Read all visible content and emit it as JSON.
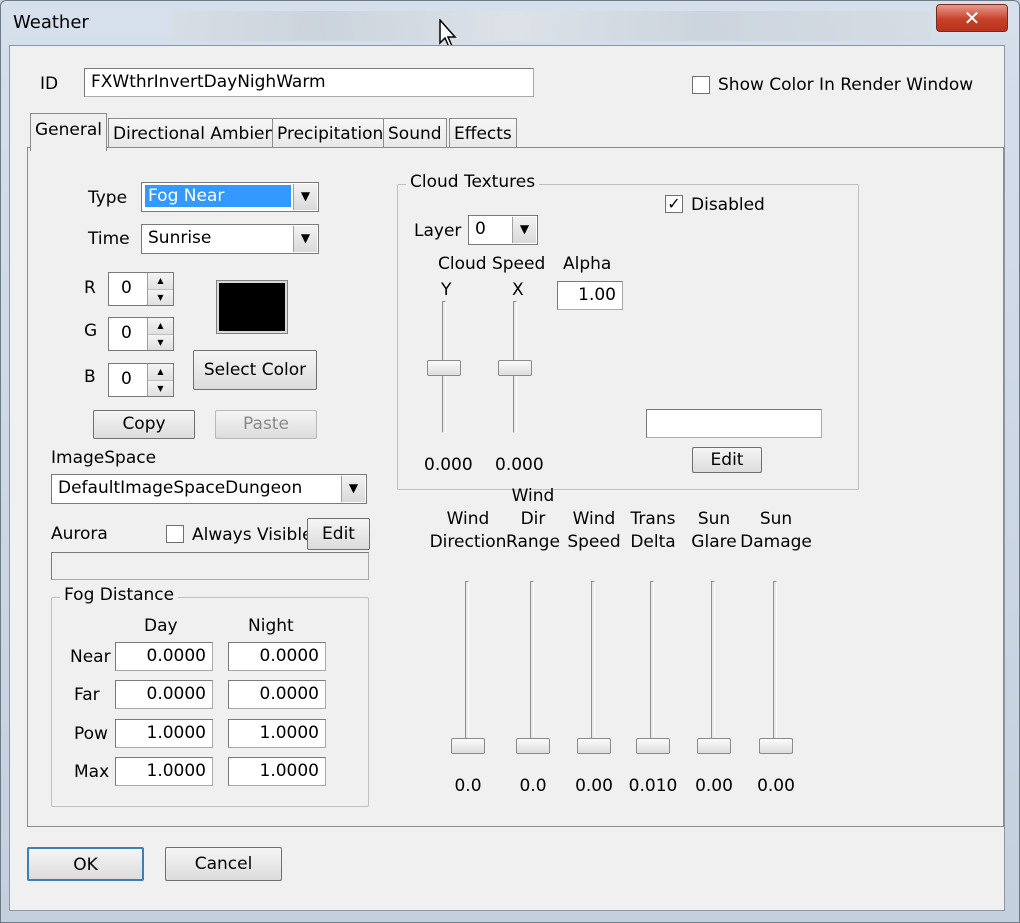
{
  "window": {
    "title": "Weather",
    "close": "✕"
  },
  "id_field": {
    "label": "ID",
    "value": "FXWthrInvertDayNighWarm"
  },
  "show_color": {
    "label": "Show Color In Render Window",
    "checked": false
  },
  "tabs": [
    {
      "label": "General",
      "active": true
    },
    {
      "label": "Directional Ambient"
    },
    {
      "label": "Precipitation"
    },
    {
      "label": "Sound"
    },
    {
      "label": "Effects"
    }
  ],
  "general": {
    "type": {
      "label": "Type",
      "value": "Fog Near"
    },
    "time": {
      "label": "Time",
      "value": "Sunrise"
    },
    "r": {
      "label": "R",
      "value": "0"
    },
    "g": {
      "label": "G",
      "value": "0"
    },
    "b": {
      "label": "B",
      "value": "0"
    },
    "color_swatch": "#000000",
    "select_color": "Select Color",
    "copy": "Copy",
    "paste": "Paste",
    "imagespace": {
      "label": "ImageSpace",
      "value": "DefaultImageSpaceDungeon"
    },
    "aurora": {
      "label": "Aurora",
      "always_visible": "Always Visible",
      "edit": "Edit",
      "path": ""
    },
    "fog": {
      "title": "Fog Distance",
      "day": "Day",
      "night": "Night",
      "rows": [
        {
          "label": "Near",
          "day": "0.0000",
          "night": "0.0000"
        },
        {
          "label": "Far",
          "day": "0.0000",
          "night": "0.0000"
        },
        {
          "label": "Pow",
          "day": "1.0000",
          "night": "1.0000"
        },
        {
          "label": "Max",
          "day": "1.0000",
          "night": "1.0000"
        }
      ]
    }
  },
  "clouds": {
    "title": "Cloud Textures",
    "disabled": {
      "label": "Disabled",
      "checked": true
    },
    "layer": {
      "label": "Layer",
      "value": "0"
    },
    "speed_label": "Cloud Speed",
    "y_label": "Y",
    "x_label": "X",
    "alpha": {
      "label": "Alpha",
      "value": "1.00"
    },
    "y_value": "0.000",
    "x_value": "0.000",
    "texture": "",
    "edit": "Edit"
  },
  "sliders": [
    {
      "label": "Wind\nDirection",
      "value": "0.0"
    },
    {
      "label": "Wind\nDir\nRange",
      "value": "0.0"
    },
    {
      "label": "Wind\nSpeed",
      "value": "0.00"
    },
    {
      "label": "Trans\nDelta",
      "value": "0.010"
    },
    {
      "label": "Sun\nGlare",
      "value": "0.00"
    },
    {
      "label": "Sun\nDamage",
      "value": "0.00"
    }
  ],
  "footer": {
    "ok": "OK",
    "cancel": "Cancel"
  },
  "icons": {
    "close": "close-icon",
    "cursor": "mouse-cursor-icon",
    "check": "checkmark-icon",
    "dropdown": "chevron-down-icon"
  }
}
